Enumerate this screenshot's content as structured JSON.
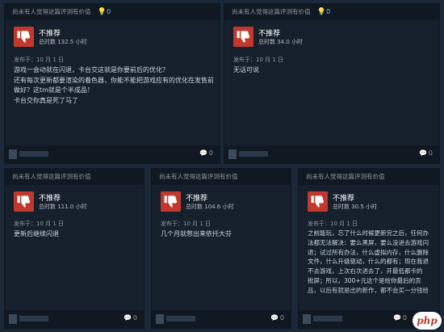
{
  "helpful_prompt": "尚未有人觉得这篇评测有价值",
  "awards_count": "0",
  "reviews": [
    {
      "verdict": "不推荐",
      "hours": "总时数 132.5 小时",
      "date": "发布于：10 月 1 日",
      "lines": [
        "游戏一会动就在闪退，卡台交这就是你要前后的优化？",
        "还有每次更新都要渲染的着色器，你能不能把游戏应有的优化在发售前",
        "做好？这tm就是个半成品！",
        "卡台交你真是死了马了"
      ],
      "comments": "0"
    },
    {
      "verdict": "不推荐",
      "hours": "总时数 34.0 小时",
      "date": "发布于：10 月 1 日",
      "lines": [
        "无话可说"
      ],
      "comments": "0"
    },
    {
      "verdict": "不推荐",
      "hours": "总时数 111.0 小时",
      "date": "发布于：10 月 1 日",
      "lines": [
        "更新后继续闪退"
      ],
      "comments": "0"
    },
    {
      "verdict": "不推荐",
      "hours": "总时数 104.6 小时",
      "date": "发布于：10 月 1 日",
      "lines": [
        "几个月就憋出来依托大芬"
      ],
      "comments": "0"
    },
    {
      "verdict": "不推荐",
      "hours": "总时数 30.5 小时",
      "date": "发布于：10 月 1 日",
      "lines": [
        "之前能玩，忘了什么时候更新完之后，任何办",
        "法都无法解决：要么黑屏，要么没进去游戏闪",
        "退；试过所有办法，什么虚拟内存，什么删除",
        "文件，什么升级驱动，什么的都有；现在我退",
        "不去游戏，上次右次进去了，开最低都卡的",
        "批屏；所以，300+元这个是给你最后的贡",
        "品，以后有就是出的新作，都不会买一分钱给"
      ],
      "comments": "0"
    }
  ],
  "watermark": "php"
}
